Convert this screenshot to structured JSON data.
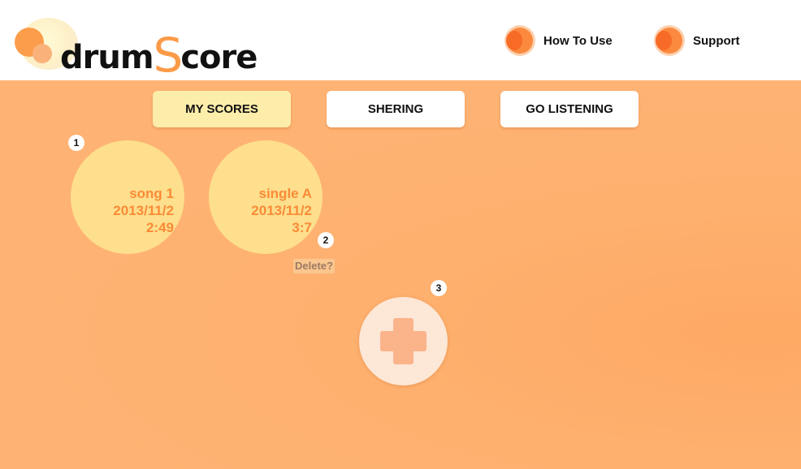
{
  "header": {
    "logo": {
      "part1": "drum",
      "part2": "S",
      "part3": "core"
    },
    "links": [
      {
        "label": "How To Use",
        "icon": "orange-circle-icon"
      },
      {
        "label": "Support",
        "icon": "orange-circle-icon"
      }
    ]
  },
  "nav": {
    "tabs": [
      {
        "label": "MY SCORES",
        "active": true
      },
      {
        "label": "SHERING",
        "active": false
      },
      {
        "label": "GO LISTENING",
        "active": false
      }
    ]
  },
  "scores": [
    {
      "title": "song 1",
      "date": "2013/11/2",
      "time": "2:49"
    },
    {
      "title": "single A",
      "date": "2013/11/2",
      "time": "3:7"
    }
  ],
  "callouts": [
    "1",
    "2",
    "3"
  ],
  "delete_label": "Delete?",
  "add_button": {
    "icon": "plus-icon"
  },
  "colors": {
    "accent": "#fb9b47",
    "background": "#feb374",
    "tab_active": "#fdedaa",
    "score_bubble": "#fddf8d",
    "score_text": "#fb8a36"
  }
}
